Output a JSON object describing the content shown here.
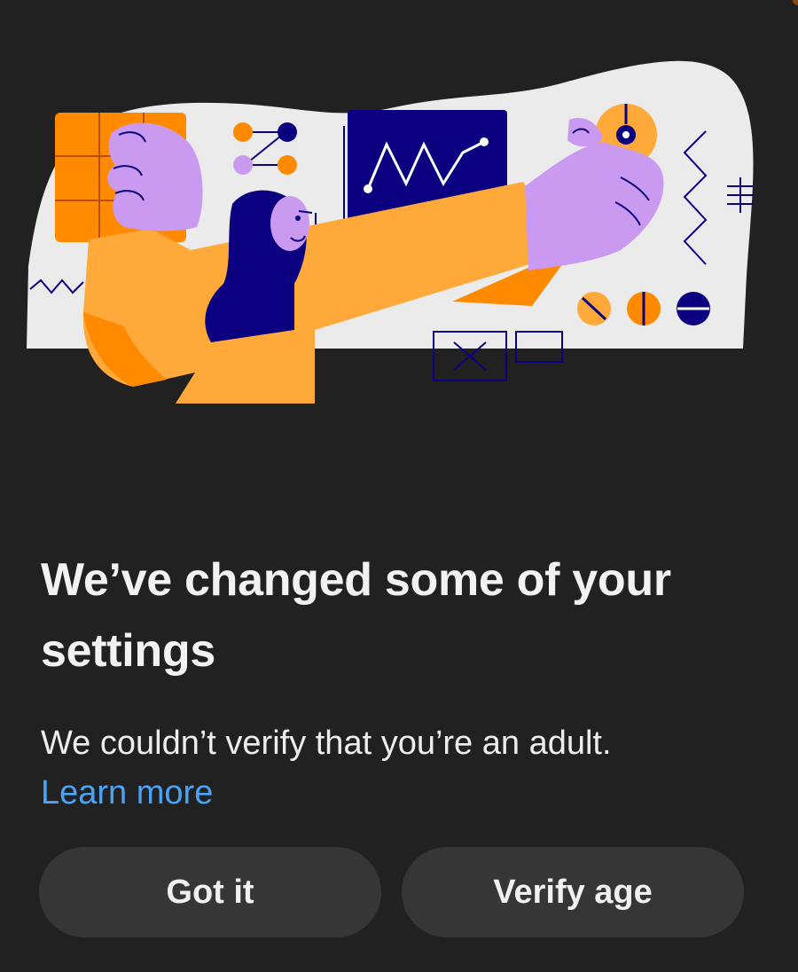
{
  "dialog": {
    "title": "We’ve changed some of your settings",
    "message": "We couldn’t verify that you’re an adult.",
    "learn_more_label": "Learn more",
    "buttons": {
      "got_it_label": "Got it",
      "verify_age_label": "Verify age"
    }
  },
  "illustration": {
    "icon": "person-adjusting-settings-illustration"
  },
  "colors": {
    "background": "#212121",
    "button_bg": "#363636",
    "title_text": "#f2f2f2",
    "link": "#4aa3f5",
    "illustration_bg": "#ebebeb",
    "orange": "#ffa93a",
    "dark_orange": "#ff8a00",
    "lavender": "#c99af0",
    "navy": "#0b0080"
  }
}
